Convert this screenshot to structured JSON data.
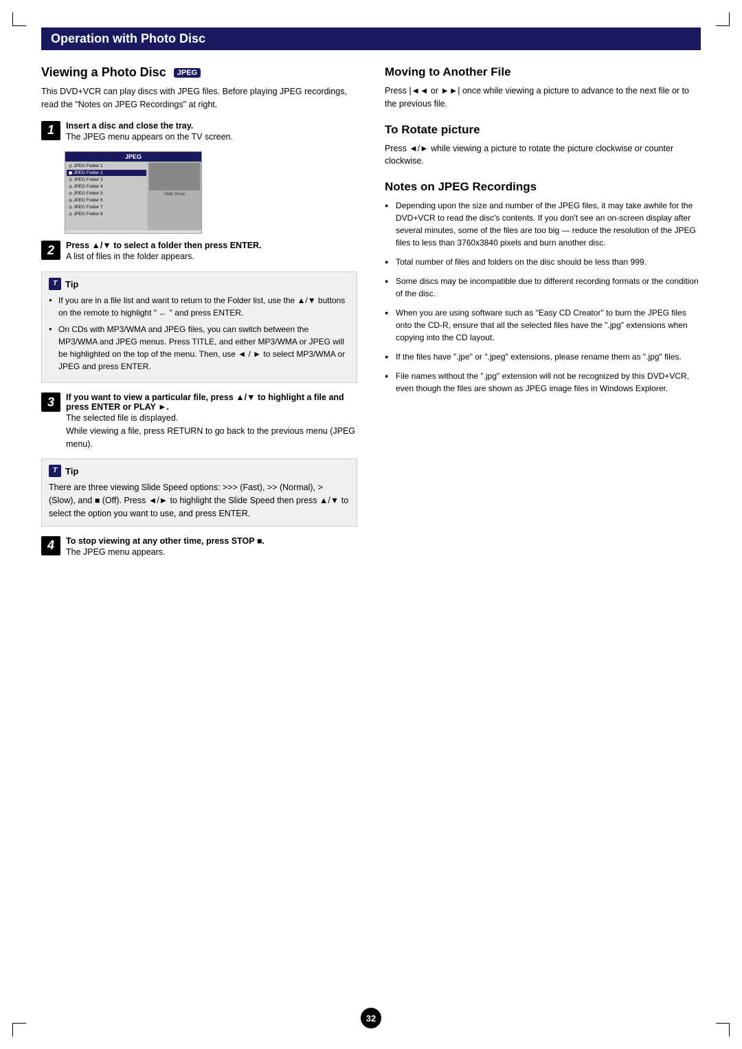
{
  "page": {
    "section_header": "Operation with Photo Disc",
    "page_number": "32"
  },
  "left_column": {
    "title": "Viewing a Photo Disc",
    "jpeg_badge": "JPEG",
    "intro": "This DVD+VCR can play discs with JPEG files. Before playing JPEG recordings, read the \"Notes on JPEG Recordings\" at right.",
    "steps": [
      {
        "number": "1",
        "bold": "Insert a disc and close the tray.",
        "text": "The JPEG menu appears on the TV screen."
      },
      {
        "number": "2",
        "bold": "Press ▲/▼ to select a folder then press ENTER.",
        "text": "A list of files in the folder appears."
      },
      {
        "number": "3",
        "bold": "If you want to view a particular file, press ▲/▼ to highlight a file and press ENTER or PLAY ►.",
        "text": "The selected file is displayed.\nWhile viewing a file, press RETURN to go back to the previous menu (JPEG menu)."
      },
      {
        "number": "4",
        "bold": "To stop viewing at any other time, press STOP ■.",
        "text": "The JPEG menu appears."
      }
    ],
    "tip1": {
      "header": "Tip",
      "items": [
        "If you are in a file list and want to return to the Folder list, use the ▲/▼ buttons on the remote to highlight \" ← \" and press ENTER.",
        "On CDs with MP3/WMA and JPEG files, you can switch between the MP3/WMA and JPEG menus. Press TITLE, and either MP3/WMA or JPEG will be highlighted on the top of the menu. Then, use ◄ / ► to select MP3/WMA or JPEG and press ENTER."
      ]
    },
    "tip2": {
      "header": "Tip",
      "text": "There are three viewing Slide Speed options: >>> (Fast), >> (Normal), > (Slow), and ■ (Off). Press ◄/► to highlight the Slide Speed then press ▲/▼ to select the option you want to use, and press ENTER."
    },
    "menu": {
      "title": "JPEG",
      "folders": [
        "JPEG Folder 1",
        "JPEG Folder 2",
        "JPEG Folder 3",
        "JPEG Folder 4",
        "JPEG Folder 5",
        "JPEG Folder 6",
        "JPEG Folder 7",
        "JPEG Folder 8"
      ]
    }
  },
  "right_column": {
    "moving_title": "Moving to Another File",
    "moving_text": "Press |◄◄ or ►►| once while viewing a picture to advance to the next file or to the previous file.",
    "rotate_title": "To Rotate picture",
    "rotate_text": "Press ◄/► while viewing a picture to rotate the picture clockwise or counter clockwise.",
    "notes_title": "Notes on JPEG Recordings",
    "notes": [
      "Depending upon the size and number of the JPEG files, it may take awhile for the DVD+VCR to read the disc's contents. If you don't see an on-screen display after several minutes, some of the files are too big — reduce the resolution of the JPEG files to less than 3760x3840 pixels and burn another disc.",
      "Total number of files and folders on the disc should be less than 999.",
      "Some discs may be incompatible due to different recording formats or the condition of the disc.",
      "When you are using software such as \"Easy CD Creator\" to burn the JPEG files onto the CD-R, ensure that all the selected files have the \".jpg\" extensions when copying into the CD layout.",
      "If the files have \".jpe\" or \".jpeg\" extensions, please rename them as \".jpg\" files.",
      "File names without the \".jpg\" extension will not be recognized by this DVD+VCR, even though the files are shown as JPEG image files in Windows Explorer."
    ]
  }
}
